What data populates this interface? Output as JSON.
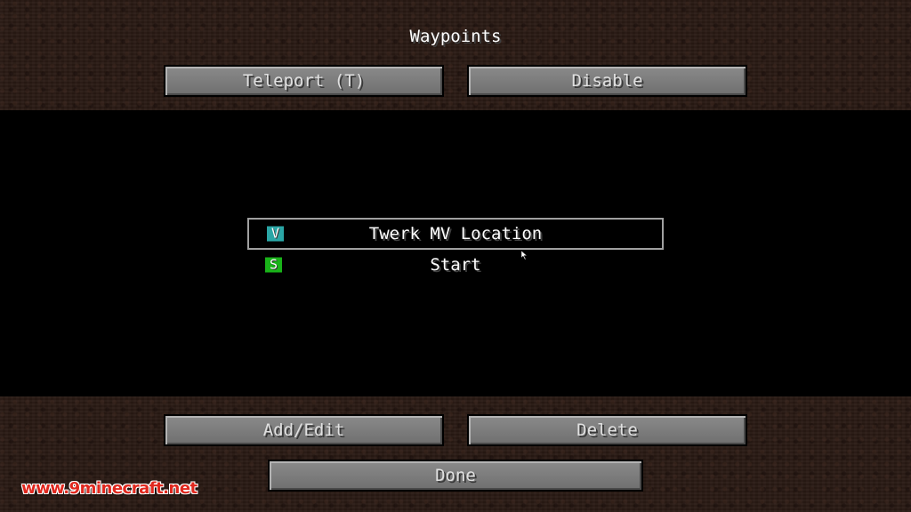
{
  "screen": {
    "title": "Waypoints"
  },
  "top_buttons": {
    "teleport_label": "Teleport (T)",
    "disable_label": "Disable"
  },
  "waypoints": [
    {
      "badge": "V",
      "name": "Twerk MV Location",
      "color": "#2aa6a6",
      "selected": true
    },
    {
      "badge": "S",
      "name": "Start",
      "color": "#19b219",
      "selected": false
    }
  ],
  "bottom_buttons": {
    "add_edit_label": "Add/Edit",
    "delete_label": "Delete",
    "done_label": "Done"
  },
  "watermark": {
    "text": "www.9minecraft.net"
  },
  "icons": {
    "cursor": "mouse-pointer-icon"
  },
  "colors": {
    "button_face": "#7a7a7a",
    "list_background": "#000000",
    "selection_border": "#a0a0a0",
    "watermark": "#e0281e"
  }
}
